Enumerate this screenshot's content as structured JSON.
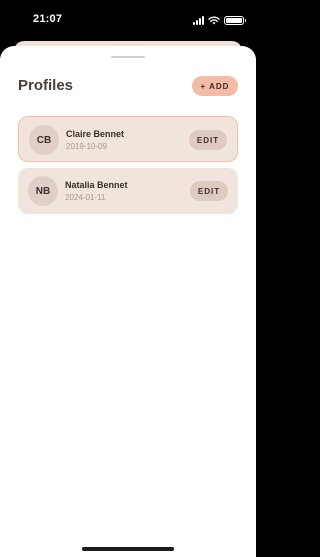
{
  "status_bar": {
    "time": "21:07"
  },
  "sheet": {
    "title": "Profiles",
    "add_label": "+ ADD"
  },
  "profiles": [
    {
      "initials": "CB",
      "name": "Claire Bennet",
      "date": "2019-10-09",
      "edit_label": "EDIT",
      "selected": true
    },
    {
      "initials": "NB",
      "name": "Natalia Bennet",
      "date": "2024-01-11",
      "edit_label": "EDIT",
      "selected": false
    }
  ],
  "icons": {
    "signal": "signal-icon",
    "wifi": "wifi-icon",
    "battery": "battery-icon"
  },
  "colors": {
    "accent": "#f4bba7",
    "card": "#f1e4dc",
    "text": "#3b2e2a"
  }
}
